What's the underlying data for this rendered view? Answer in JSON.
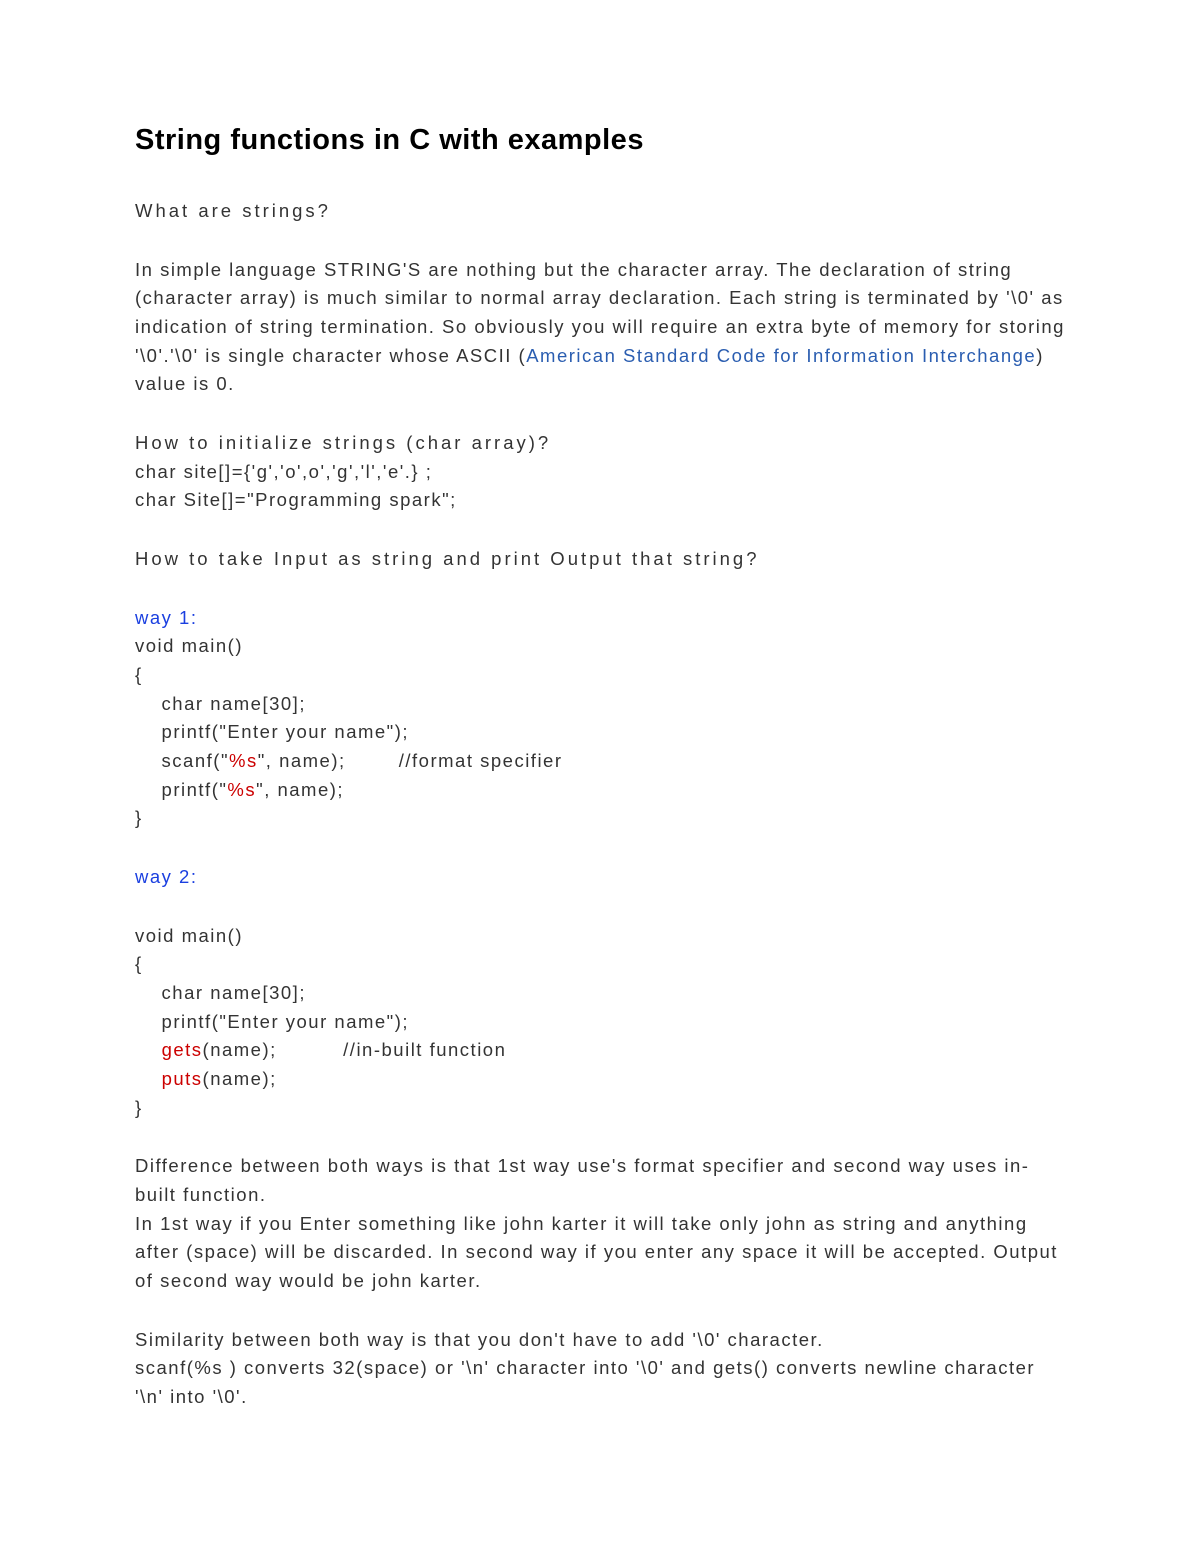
{
  "title": "String functions in C with examples",
  "subhead1": "What are strings?",
  "intro": {
    "pre": "In simple language STRING'S are nothing but the character array. The declaration of string (character array) is much similar to normal array declaration. Each string is terminated by '\\0' as indication of string termination. So obviously you will require an extra byte of memory for storing '\\0'.'\\0' is single character whose ASCII (",
    "link": "American Standard Code for Information Interchange",
    "post": ") value is 0."
  },
  "init": {
    "heading": "How to initialize strings (char array)?",
    "line1": "char site[]={'g','o',o','g','l','e'.} ;",
    "line2": "char Site[]=\"Programming spark\";"
  },
  "iohead": "How to take Input as string and print Output that string?",
  "way1": {
    "label": "way 1:",
    "l1": "void main()",
    "l2": "{",
    "l3a": "    char name[30];",
    "l3b": "    printf(\"Enter your name\");",
    "l3c_pre": "    scanf(\"",
    "l3c_fmt": "%s",
    "l3c_post": "\", name);        //format specifier",
    "l3d_pre": "    printf(\"",
    "l3d_fmt": "%s",
    "l3d_post": "\", name);",
    "l4": "}"
  },
  "way2": {
    "label": "way 2:",
    "l1": "void main()",
    "l2": "{",
    "l3a": "    char name[30];",
    "l3b": "    printf(\"Enter your name\");",
    "l3c_pre": "    ",
    "l3c_fn": "gets",
    "l3c_post": "(name);          //in-built function",
    "l3d_pre": "    ",
    "l3d_fn": "puts",
    "l3d_post": "(name);",
    "l4": "}"
  },
  "diff": "Difference between both ways is that 1st way use's format specifier and second way uses in-built function.\nIn 1st way if you Enter something like john karter it will take only john as string and anything after (space) will be discarded. In second way if you enter any space it will be accepted. Output of second way would be john karter.",
  "sim": "Similarity between both way is that you don't have to add '\\0' character.\nscanf(%s ) converts 32(space) or '\\n' character into '\\0' and  gets() converts newline character '\\n' into '\\0'."
}
